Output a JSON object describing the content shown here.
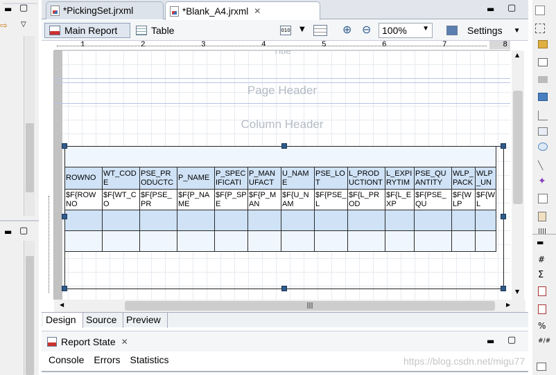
{
  "tabs": [
    {
      "label": "*PickingSet.jrxml"
    },
    {
      "label": "*Blank_A4.jrxml"
    }
  ],
  "toolbar": {
    "main_report": "Main Report",
    "table": "Table",
    "zoom": "100%",
    "settings": "Settings"
  },
  "ruler": {
    "marks": [
      "1",
      "2",
      "3",
      "4",
      "5",
      "6",
      "7",
      "8"
    ]
  },
  "bands": {
    "title": "Title",
    "page_header": "Page Header",
    "column_header": "Column Header"
  },
  "table": {
    "headers": [
      "ROWNO",
      "WT_CODE",
      "PSE_PRODUCTC",
      "P_NAME",
      "P_SPECIFICATI",
      "P_MANUFACT",
      "U_NAME",
      "PSE_LOT",
      "L_PRODUCTIONT",
      "L_EXPIRYTIM",
      "PSE_QUANTITY",
      "WLP_PACK",
      "WLP_UN"
    ],
    "fields": [
      "$F{ROWNO",
      "$F{WT_CO",
      "$F{PSE_PR",
      "$F{P_NAME",
      "$F{P_SPE",
      "$F{P_MAN",
      "$F{U_NAM",
      "$F{PSE_L",
      "$F{L_PROD",
      "$F{L_EXP",
      "$F{PSE_QU",
      "$F{WLP",
      "$F{WL"
    ]
  },
  "bottom_tabs": [
    "Design",
    "Source",
    "Preview"
  ],
  "report_state": {
    "label": "Report State"
  },
  "console_tabs": [
    "Console",
    "Errors",
    "Statistics"
  ],
  "watermark": "https://blog.csdn.net/migu77"
}
